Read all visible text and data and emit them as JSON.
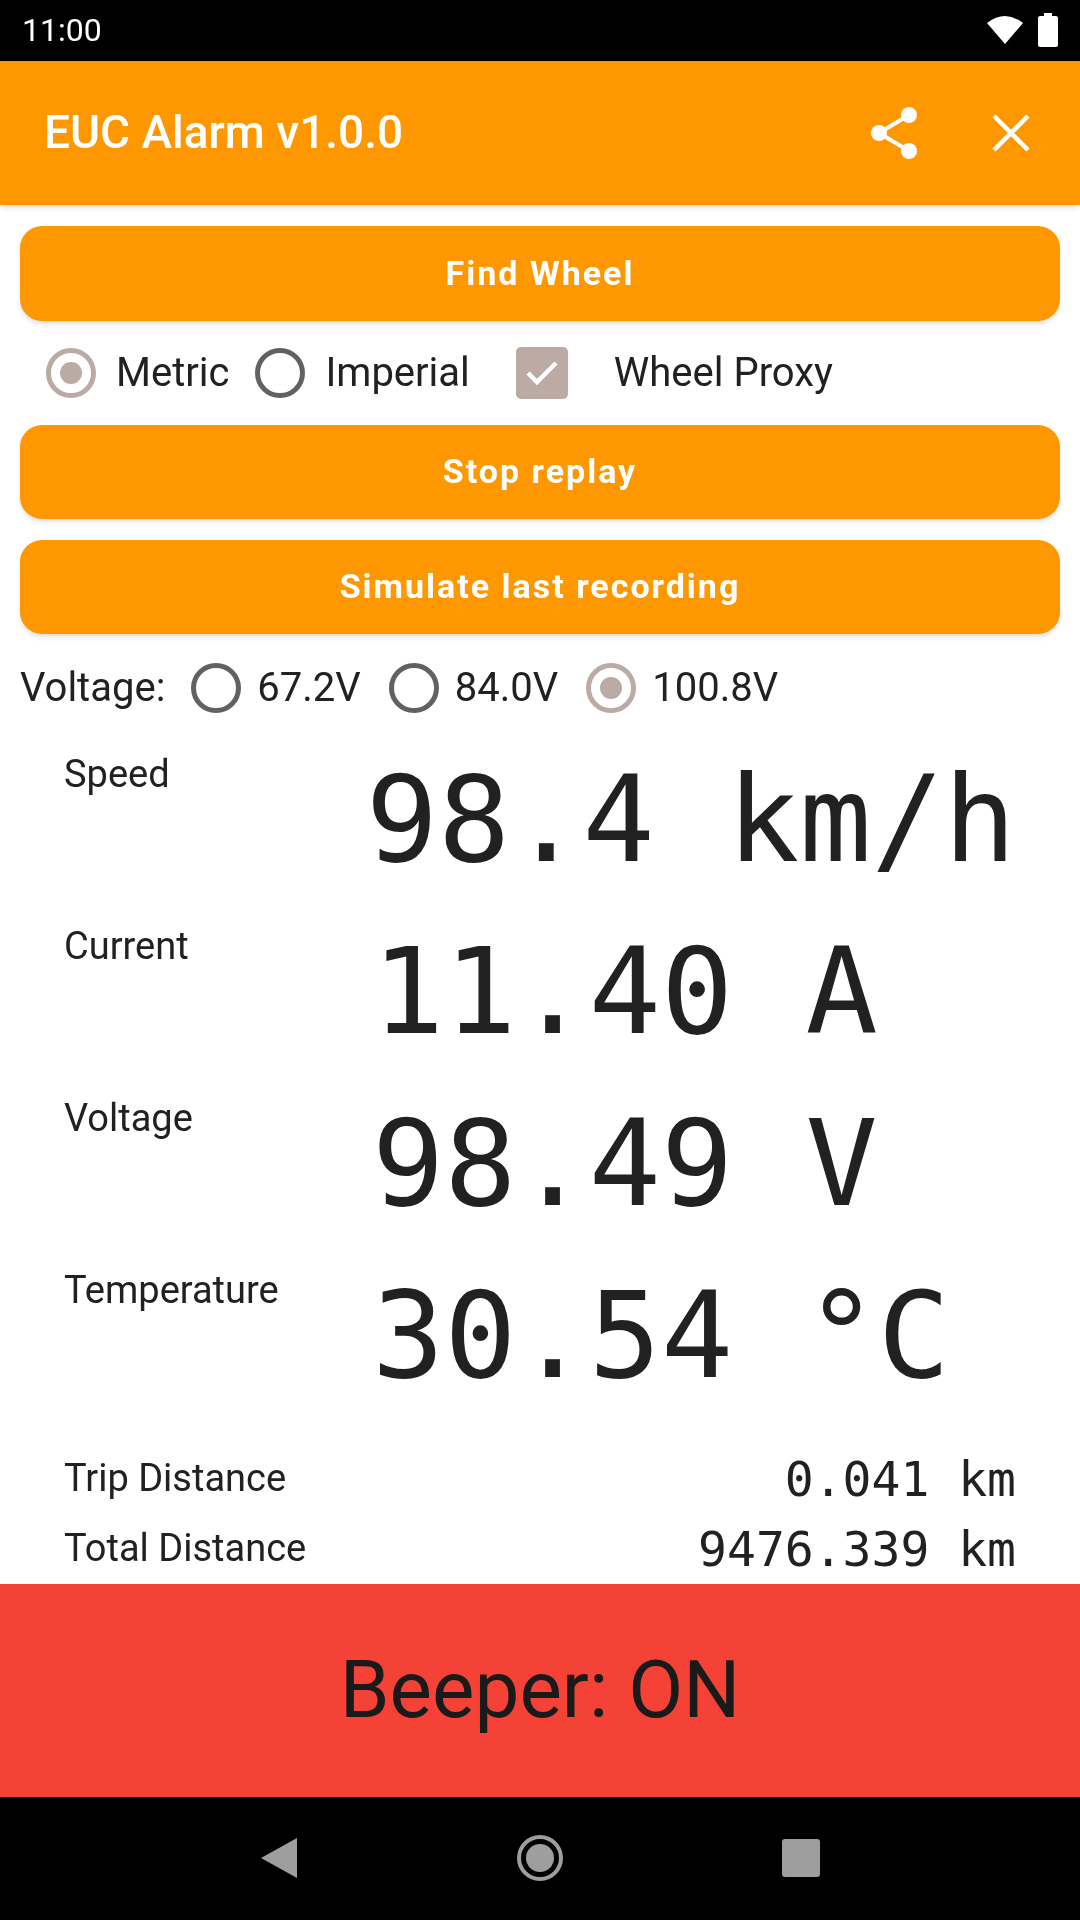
{
  "status_bar": {
    "time": "11:00"
  },
  "app_bar": {
    "title": "EUC Alarm v1.0.0"
  },
  "find_button": "Find Wheel",
  "options": [
    {
      "kind": "radio",
      "label": "Metric",
      "selected": true
    },
    {
      "kind": "radio",
      "label": "Imperial",
      "selected": false
    },
    {
      "kind": "checkbox",
      "label": "Wheel Proxy",
      "checked": true
    }
  ],
  "buttons": [
    "Stop replay",
    "Simulate last recording"
  ],
  "voltage_select": {
    "label": "Voltage:",
    "options": [
      {
        "label": "67.2V",
        "selected": false
      },
      {
        "label": "84.0V",
        "selected": false
      },
      {
        "label": "100.8V",
        "selected": true
      }
    ]
  },
  "readings": [
    {
      "label": "Speed",
      "value": "98.4 km/h"
    },
    {
      "label": "Current",
      "value": "11.40 A"
    },
    {
      "label": "Voltage",
      "value": "98.49 V"
    },
    {
      "label": "Temperature",
      "value": "30.54 °C"
    }
  ],
  "distances": [
    {
      "label": "Trip Distance",
      "value": "0.041 km"
    },
    {
      "label": "Total Distance",
      "value": "9476.339 km"
    }
  ],
  "beeper": {
    "label": "Beeper: ON",
    "on": true
  }
}
